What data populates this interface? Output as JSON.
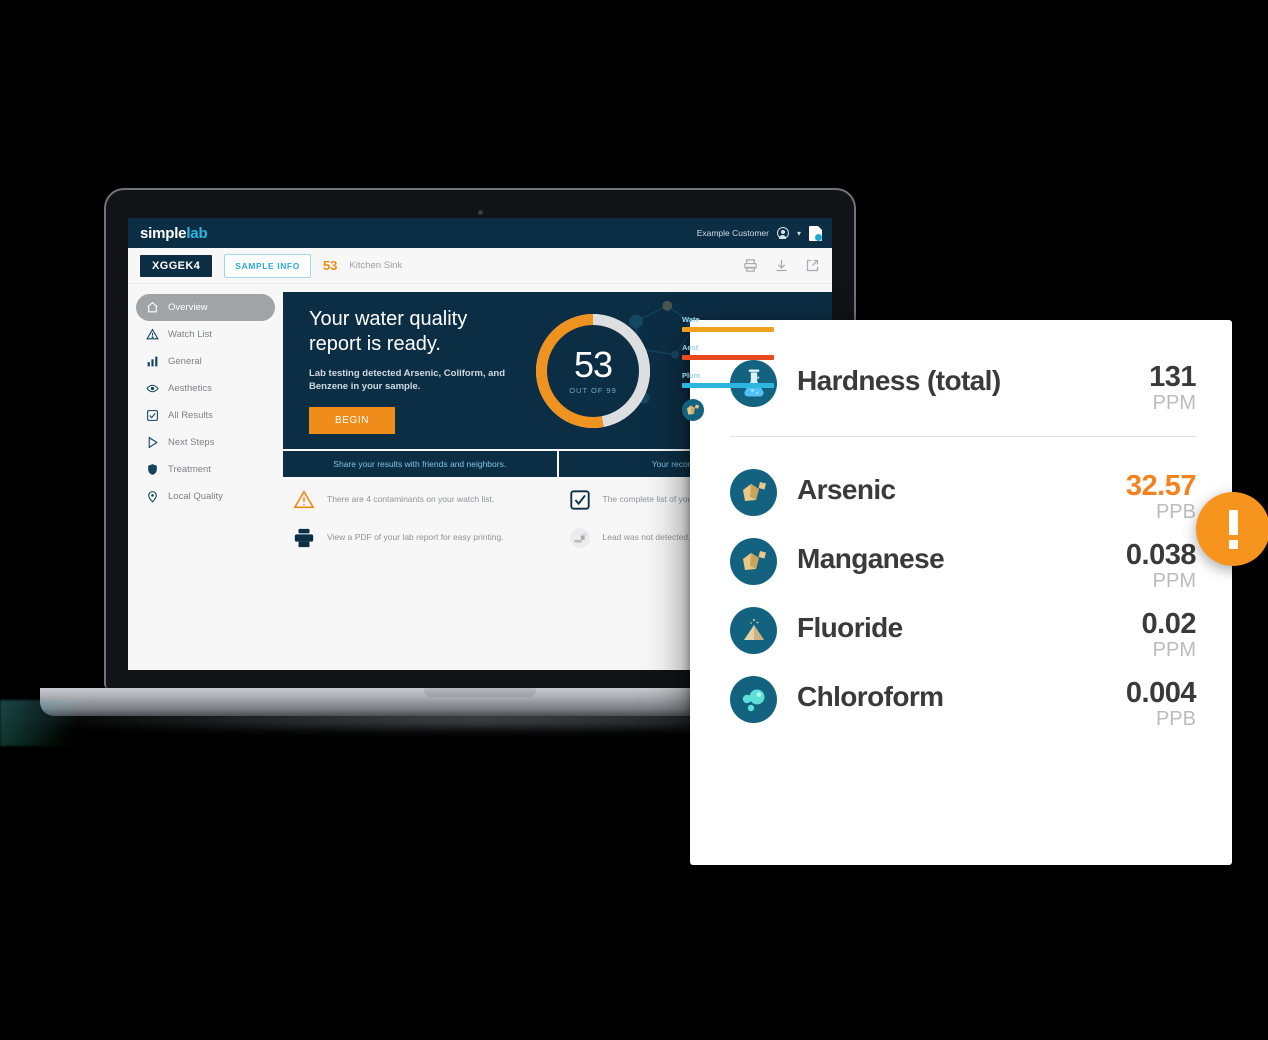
{
  "app": {
    "logo_primary": "simple",
    "logo_secondary": "lab",
    "customer": "Example Customer",
    "avatar_icon": "user-circle-icon",
    "chevron_icon": "chevron-down-icon",
    "report_doc_icon": "document-icon"
  },
  "subbar": {
    "sample_id": "XGGEK4",
    "sample_info_label": "SAMPLE INFO",
    "score": "53",
    "location": "Kitchen Sink",
    "print_icon": "print-icon",
    "download_icon": "download-icon",
    "share_icon": "share-icon"
  },
  "sidebar": {
    "items": [
      {
        "label": "Overview",
        "icon": "home-icon",
        "active": true
      },
      {
        "label": "Watch List",
        "icon": "warning-triangle-icon",
        "active": false
      },
      {
        "label": "General",
        "icon": "bar-chart-icon",
        "active": false
      },
      {
        "label": "Aesthetics",
        "icon": "eye-icon",
        "active": false
      },
      {
        "label": "All Results",
        "icon": "checkbox-icon",
        "active": false
      },
      {
        "label": "Next Steps",
        "icon": "play-triangle-icon",
        "active": false
      },
      {
        "label": "Treatment",
        "icon": "shield-icon",
        "active": false
      },
      {
        "label": "Local Quality",
        "icon": "map-pin-icon",
        "active": false
      }
    ]
  },
  "hero": {
    "heading": "Your water quality report is ready.",
    "subtext": "Lab testing detected Arsenic, Coliform, and Benzene in your sample.",
    "begin_label": "BEGIN",
    "gauge_score": "53",
    "gauge_out_of": "OUT OF 99",
    "gauge_max": 99,
    "gauge_fill_color": "#ef9320",
    "gauge_track_color": "#dddee0",
    "categories": [
      {
        "label": "Wate",
        "color": "#f0a11e"
      },
      {
        "label": "Aest",
        "color": "#e8491d"
      },
      {
        "label": "Plum",
        "color": "#2fb6e0"
      }
    ]
  },
  "strips": [
    {
      "heading": "Share your results with friends and neighbors.",
      "facts": [
        {
          "icon": "warning-triangle-icon",
          "text": "There are 4 contaminants on your watch list."
        },
        {
          "icon": "print-icon",
          "text": "View a PDF of your lab report for easy printing."
        }
      ]
    },
    {
      "heading": "Your recommendations",
      "facts": [
        {
          "icon": "checkbox-icon",
          "text": "The complete list of your All Results section."
        },
        {
          "icon": "faucet-icon",
          "text": "Lead was not detected."
        }
      ]
    }
  ],
  "results_card": {
    "primary": {
      "icon": "flask-icon",
      "name": "Hardness (total)",
      "value": "131",
      "unit": "PPM",
      "alert": false
    },
    "items": [
      {
        "icon": "mineral-icon",
        "name": "Arsenic",
        "value": "32.57",
        "unit": "PPB",
        "alert": true
      },
      {
        "icon": "mineral-icon",
        "name": "Manganese",
        "value": "0.038",
        "unit": "PPM",
        "alert": false
      },
      {
        "icon": "powder-icon",
        "name": "Fluoride",
        "value": "0.02",
        "unit": "PPM",
        "alert": false
      },
      {
        "icon": "bubbles-icon",
        "name": "Chloroform",
        "value": "0.004",
        "unit": "PPB",
        "alert": false
      }
    ]
  },
  "alert_badge": {
    "icon": "exclamation-icon",
    "color": "#f7941e"
  },
  "colors": {
    "brand_navy": "#0c2e45",
    "brand_orange": "#f08c1a",
    "brand_cyan": "#2fb6e0",
    "icon_teal": "#126280"
  }
}
